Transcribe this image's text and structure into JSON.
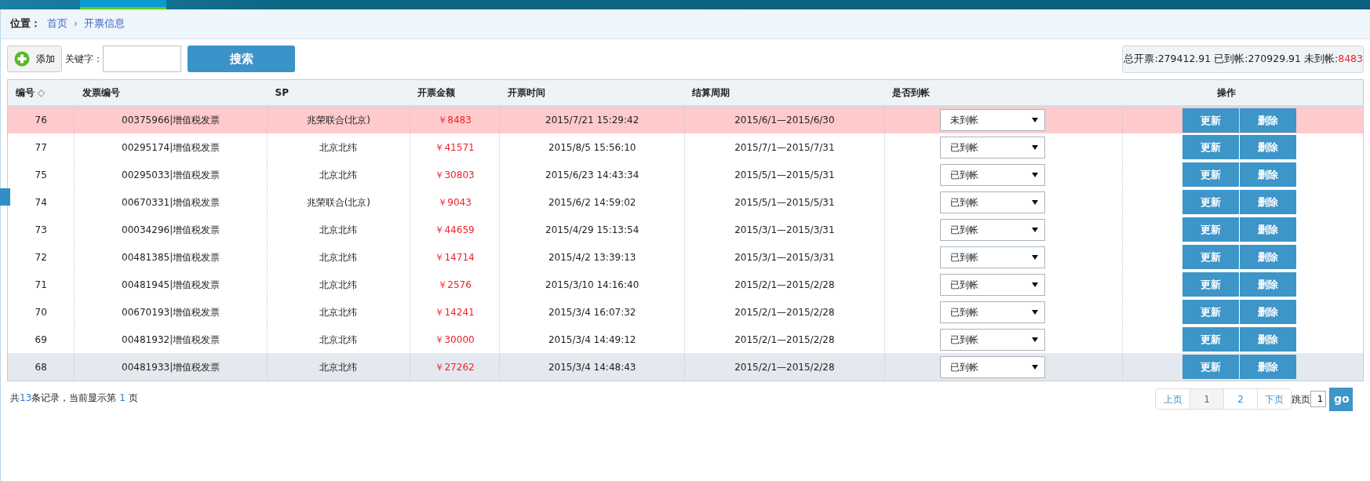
{
  "breadcrumb": {
    "label": "位置：",
    "items": [
      {
        "text": "首页"
      },
      {
        "text": "开票信息"
      }
    ],
    "separator": "›"
  },
  "toolbar": {
    "add_button": "添加",
    "keyword_label": "关键字：",
    "search_button": "搜索"
  },
  "summary": {
    "total_label": "总开票:",
    "total": "279412.91",
    "paid_label": "已到帐:",
    "paid": "270929.91",
    "unpaid_label": "未到帐:",
    "unpaid": "8483"
  },
  "table": {
    "columns": [
      "编号",
      "发票编号",
      "SP",
      "开票金额",
      "开票时间",
      "结算周期",
      "是否到帐",
      "操作"
    ],
    "sort_icon": "◇",
    "rows": [
      {
        "id": "76",
        "invoice": "00375966|增值税发票",
        "sp": "兆荣联合(北京)",
        "amount": "￥8483",
        "time": "2015/7/21 15:29:42",
        "period": "2015/6/1—2015/6/30",
        "status": "未到帐",
        "paid": false,
        "hovered": false,
        "actions": [
          "更新",
          "删除"
        ]
      },
      {
        "id": "77",
        "invoice": "00295174|增值税发票",
        "sp": "北京北纬",
        "amount": "￥41571",
        "time": "2015/8/5 15:56:10",
        "period": "2015/7/1—2015/7/31",
        "status": "已到帐",
        "paid": true,
        "hovered": false,
        "actions": [
          "更新",
          "删除"
        ]
      },
      {
        "id": "75",
        "invoice": "00295033|增值税发票",
        "sp": "北京北纬",
        "amount": "￥30803",
        "time": "2015/6/23 14:43:34",
        "period": "2015/5/1—2015/5/31",
        "status": "已到帐",
        "paid": true,
        "hovered": false,
        "actions": [
          "更新",
          "删除"
        ]
      },
      {
        "id": "74",
        "invoice": "00670331|增值税发票",
        "sp": "兆荣联合(北京)",
        "amount": "￥9043",
        "time": "2015/6/2 14:59:02",
        "period": "2015/5/1—2015/5/31",
        "status": "已到帐",
        "paid": true,
        "hovered": false,
        "actions": [
          "更新",
          "删除"
        ]
      },
      {
        "id": "73",
        "invoice": "00034296|增值税发票",
        "sp": "北京北纬",
        "amount": "￥44659",
        "time": "2015/4/29 15:13:54",
        "period": "2015/3/1—2015/3/31",
        "status": "已到帐",
        "paid": true,
        "hovered": false,
        "actions": [
          "更新",
          "删除"
        ]
      },
      {
        "id": "72",
        "invoice": "00481385|增值税发票",
        "sp": "北京北纬",
        "amount": "￥14714",
        "time": "2015/4/2 13:39:13",
        "period": "2015/3/1—2015/3/31",
        "status": "已到帐",
        "paid": true,
        "hovered": false,
        "actions": [
          "更新",
          "删除"
        ]
      },
      {
        "id": "71",
        "invoice": "00481945|增值税发票",
        "sp": "北京北纬",
        "amount": "￥2576",
        "time": "2015/3/10 14:16:40",
        "period": "2015/2/1—2015/2/28",
        "status": "已到帐",
        "paid": true,
        "hovered": false,
        "actions": [
          "更新",
          "删除"
        ]
      },
      {
        "id": "70",
        "invoice": "00670193|增值税发票",
        "sp": "北京北纬",
        "amount": "￥14241",
        "time": "2015/3/4 16:07:32",
        "period": "2015/2/1—2015/2/28",
        "status": "已到帐",
        "paid": true,
        "hovered": false,
        "actions": [
          "更新",
          "删除"
        ]
      },
      {
        "id": "69",
        "invoice": "00481932|增值税发票",
        "sp": "北京北纬",
        "amount": "￥30000",
        "time": "2015/3/4 14:49:12",
        "period": "2015/2/1—2015/2/28",
        "status": "已到帐",
        "paid": true,
        "hovered": false,
        "actions": [
          "更新",
          "删除"
        ]
      },
      {
        "id": "68",
        "invoice": "00481933|增值税发票",
        "sp": "北京北纬",
        "amount": "￥27262",
        "time": "2015/3/4 14:48:43",
        "period": "2015/2/1—2015/2/28",
        "status": "已到帐",
        "paid": true,
        "hovered": true,
        "actions": [
          "更新",
          "删除"
        ]
      }
    ]
  },
  "footer": {
    "record_text": "共**13**条记录，当前显示第 **1** 页"
  },
  "pagination": {
    "pages": [
      {
        "label": "上页",
        "selected": false
      },
      {
        "label": "1",
        "selected": true
      },
      {
        "label": "2",
        "selected": false
      },
      {
        "label": "下页",
        "selected": false
      }
    ],
    "jump_label": "跳页",
    "jump_value": "1",
    "go_button": "go"
  }
}
